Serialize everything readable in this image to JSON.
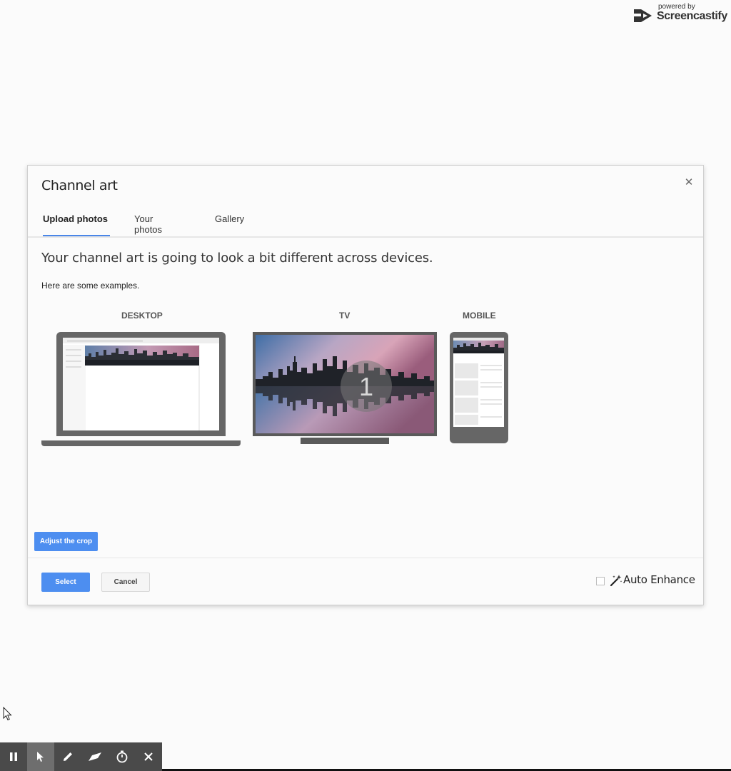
{
  "watermark": {
    "powered_by": "powered by",
    "brand": "Screencastify"
  },
  "dialog": {
    "title": "Channel art",
    "close_icon": "close-icon",
    "tabs": [
      {
        "label": "Upload photos",
        "active": true
      },
      {
        "label": "Your photos",
        "active": false
      },
      {
        "label": "Gallery",
        "active": false
      }
    ],
    "headline": "Your channel art is going to look a bit different across devices.",
    "subtext": "Here are some examples.",
    "devices": {
      "desktop": "DESKTOP",
      "tv": "TV",
      "mobile": "MOBILE"
    },
    "tv_overlay_number": "1",
    "adjust_crop_label": "Adjust the crop",
    "select_label": "Select",
    "cancel_label": "Cancel",
    "auto_enhance_label": "Auto Enhance",
    "auto_enhance_checked": false
  },
  "toolbar": {
    "tools": [
      "pause-icon",
      "pointer-icon",
      "pen-icon",
      "eraser-icon",
      "timer-icon",
      "close-icon"
    ],
    "active_tool": "pointer-icon"
  },
  "colors": {
    "accent": "#4d8ef0",
    "toolbar": "#4a4a4a",
    "device": "#666666"
  }
}
